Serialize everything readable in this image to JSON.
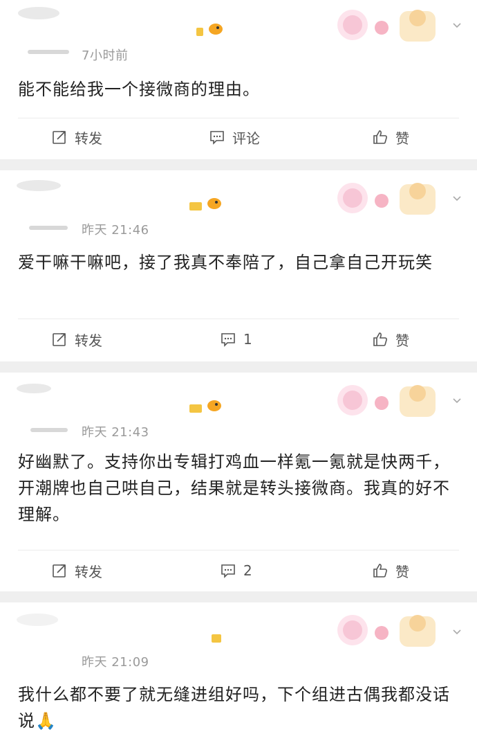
{
  "posts": [
    {
      "time": "7小时前",
      "text": "能不能给我一个接微商的理由。",
      "actions": {
        "repost": "转发",
        "comment": "评论",
        "like": "赞"
      }
    },
    {
      "time": "昨天 21:46",
      "text": "爱干嘛干嘛吧，接了我真不奉陪了，自己拿自己开玩笑",
      "actions": {
        "repost": "转发",
        "comment": "1",
        "like": "赞"
      }
    },
    {
      "time": "昨天 21:43",
      "text": "好幽默了。支持你出专辑打鸡血一样氪一氪就是快两千，开潮牌也自己哄自己，结果就是转头接微商。我真的好不理解。",
      "actions": {
        "repost": "转发",
        "comment": "2",
        "like": "赞"
      }
    },
    {
      "time": "昨天 21:09",
      "text": "我什么都不要了就无缝进组好吗，下个组进古偶我都没话说🙏"
    }
  ],
  "colors": {
    "separator": "#efefef",
    "text": "#222222",
    "meta": "#9a9a9a",
    "action": "#555555"
  }
}
